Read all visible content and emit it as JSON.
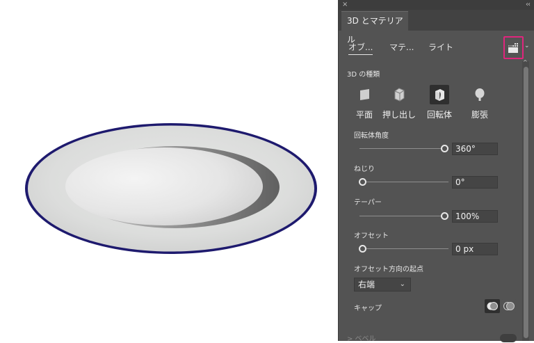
{
  "panel": {
    "close_glyph": "×",
    "collapse_glyph": "‹‹",
    "title": "3D とマテリアル",
    "tabs": [
      {
        "label": "オブ..."
      },
      {
        "label": "マテ..."
      },
      {
        "label": "ライト"
      }
    ],
    "render_menu_glyph": "⌄",
    "scroll_up_glyph": "^"
  },
  "type_section": {
    "heading": "3D の種類",
    "items": [
      {
        "label": "平面",
        "icon": "plane-icon"
      },
      {
        "label": "押し出し",
        "icon": "extrude-icon"
      },
      {
        "label": "回転体",
        "icon": "revolve-icon",
        "selected": true
      },
      {
        "label": "膨張",
        "icon": "inflate-icon"
      }
    ]
  },
  "properties": {
    "revolve_angle": {
      "label": "回転体角度",
      "value": "360°",
      "level": 1.0
    },
    "twist": {
      "label": "ねじり",
      "value": "0°",
      "level": 0.0
    },
    "taper": {
      "label": "テーパー",
      "value": "100%",
      "level": 1.0
    },
    "offset": {
      "label": "オフセット",
      "value": "0 px",
      "level": 0.0
    },
    "offset_origin": {
      "label": "オフセット方向の起点",
      "value": "右端"
    },
    "cap": {
      "label": "キャップ"
    }
  },
  "bevel": {
    "label": "> ベベル"
  },
  "colors": {
    "panel_bg": "#535353",
    "highlight": "#e0257d",
    "plate_rim": "#1e1a6e"
  }
}
